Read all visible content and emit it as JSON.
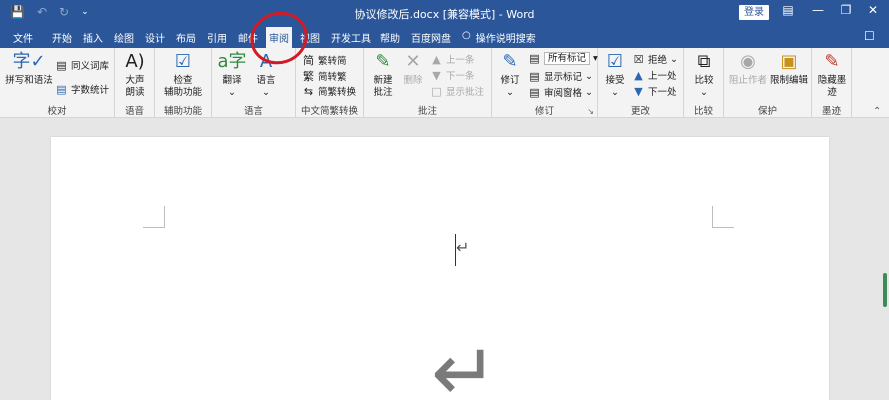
{
  "titlebar": {
    "doc_title": "协议修改后.docx [兼容模式] - Word",
    "login_label": "登录",
    "save_icon": "save-icon",
    "undo_icon": "undo-icon",
    "redo_icon": "redo-icon"
  },
  "tabs": [
    {
      "label": "文件"
    },
    {
      "label": "开始"
    },
    {
      "label": "插入"
    },
    {
      "label": "绘图"
    },
    {
      "label": "设计"
    },
    {
      "label": "布局"
    },
    {
      "label": "引用"
    },
    {
      "label": "邮件"
    },
    {
      "label": "审阅",
      "active": true
    },
    {
      "label": "视图"
    },
    {
      "label": "开发工具"
    },
    {
      "label": "帮助"
    },
    {
      "label": "百度网盘"
    }
  ],
  "tell_me": "操作说明搜索",
  "ribbon": {
    "proofing": {
      "spelling": "拼写和语法",
      "thesaurus": "同义词库",
      "word_count": "字数统计",
      "label": "校对"
    },
    "speech": {
      "read_aloud_1": "大声",
      "read_aloud_2": "朗读",
      "label": "语音"
    },
    "accessibility": {
      "check_1": "检查",
      "check_2": "辅助功能",
      "label": "辅助功能"
    },
    "language": {
      "translate": "翻译",
      "language": "语言",
      "label": "语言"
    },
    "chinese_conv": {
      "to_simplified": "繁转简",
      "to_traditional": "简转繁",
      "convert": "简繁转换",
      "label": "中文简繁转换"
    },
    "comments": {
      "new_1": "新建",
      "new_2": "批注",
      "delete": "删除",
      "prev": "上一条",
      "next": "下一条",
      "show": "显示批注",
      "label": "批注"
    },
    "tracking": {
      "track_changes": "修订",
      "markup_select": "所有标记",
      "show_markup": "显示标记",
      "reviewing_pane": "审阅窗格",
      "label": "修订"
    },
    "changes": {
      "accept": "接受",
      "reject": "拒绝",
      "previous": "上一处",
      "next": "下一处",
      "label": "更改"
    },
    "compare": {
      "compare": "比较",
      "label": "比较"
    },
    "protect": {
      "block_1": "阻止作者",
      "restrict": "限制编辑",
      "label": "保护"
    },
    "ink": {
      "hide_1": "隐藏墨",
      "hide_2": "迹",
      "label": "墨迹"
    }
  }
}
